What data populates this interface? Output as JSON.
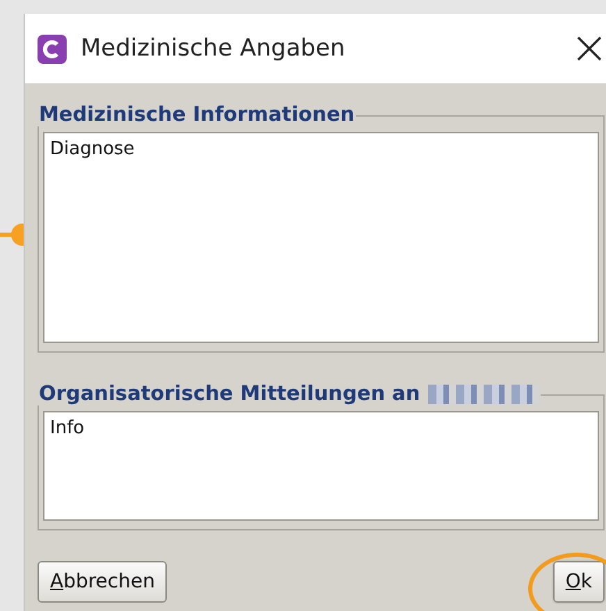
{
  "window": {
    "title": "Medizinische Angaben"
  },
  "groups": [
    {
      "legend": "Medizinische Informationen",
      "value": "Diagnose",
      "redacted": false
    },
    {
      "legend": "Organisatorische Mitteilungen an",
      "value": "Info",
      "redacted": true
    }
  ],
  "buttons": [
    {
      "label": "Abbrechen",
      "highlighted": false
    },
    {
      "label": "Ok",
      "highlighted": true
    }
  ]
}
